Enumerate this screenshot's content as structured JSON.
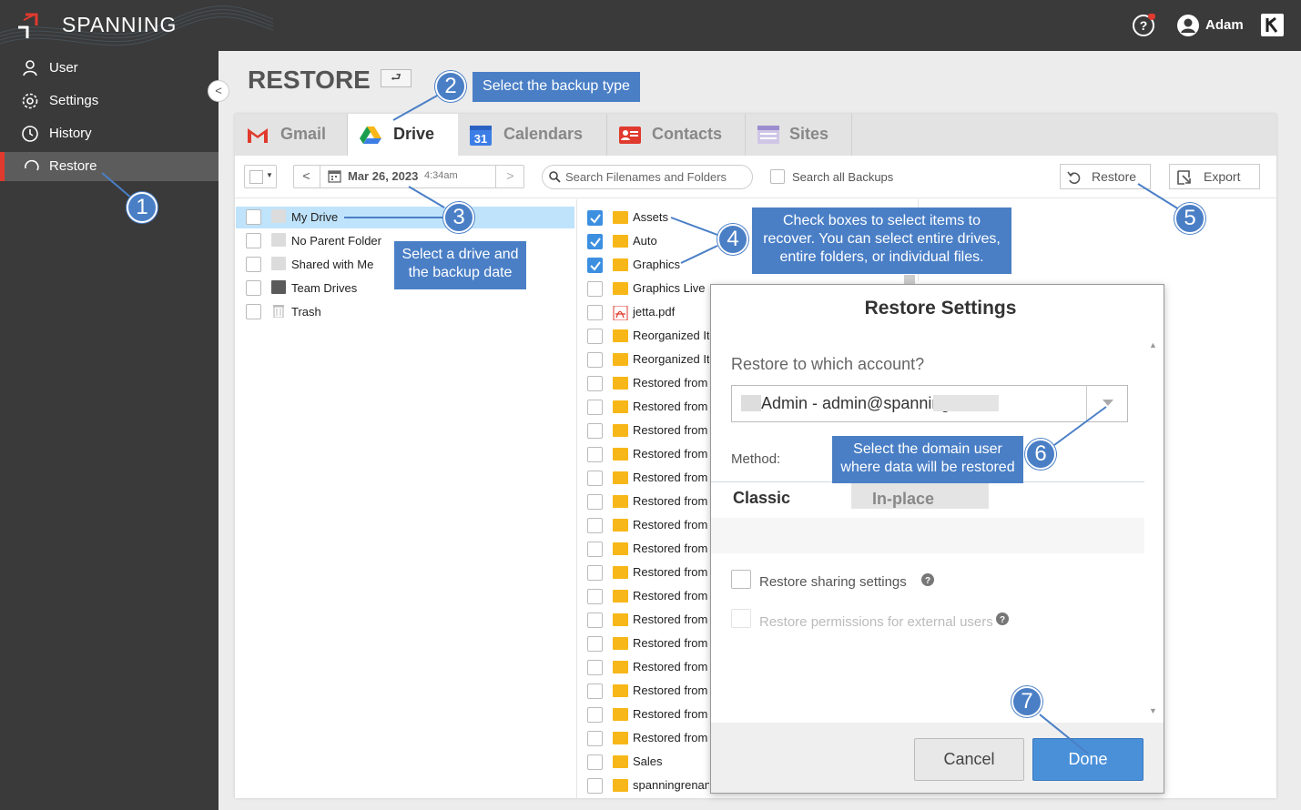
{
  "app": {
    "name": "SPANNING",
    "user": "Adam"
  },
  "sidebar": {
    "items": [
      {
        "label": "User",
        "icon": "user-icon"
      },
      {
        "label": "Settings",
        "icon": "gear-icon"
      },
      {
        "label": "History",
        "icon": "clock-icon"
      },
      {
        "label": "Restore",
        "icon": "restore-icon",
        "active": true
      }
    ]
  },
  "page": {
    "title": "RESTORE",
    "back_label": "⮐"
  },
  "tabs": [
    {
      "label": "Gmail",
      "icon": "gmail-icon"
    },
    {
      "label": "Drive",
      "icon": "drive-icon",
      "active": true
    },
    {
      "label": "Calendars",
      "icon": "calendar-icon",
      "icon_text": "31"
    },
    {
      "label": "Contacts",
      "icon": "contacts-icon"
    },
    {
      "label": "Sites",
      "icon": "sites-icon"
    }
  ],
  "toolbar": {
    "date": "Mar 26, 2023",
    "time": "4:34am",
    "search_placeholder": "Search Filenames and Folders",
    "search_all_label": "Search all Backups",
    "restore_label": "Restore",
    "export_label": "Export"
  },
  "drives": [
    {
      "label": "My Drive",
      "selected": true
    },
    {
      "label": "No Parent Folder"
    },
    {
      "label": "Shared with Me"
    },
    {
      "label": "Team Drives"
    },
    {
      "label": "Trash"
    }
  ],
  "files": [
    {
      "label": "Assets",
      "type": "folder",
      "checked": true
    },
    {
      "label": "Auto",
      "type": "folder",
      "checked": true
    },
    {
      "label": "Graphics",
      "type": "folder",
      "checked": true
    },
    {
      "label": "Graphics Live",
      "type": "folder"
    },
    {
      "label": "jetta.pdf",
      "type": "pdf"
    },
    {
      "label": "Reorganized It",
      "type": "folder"
    },
    {
      "label": "Reorganized It",
      "type": "folder"
    },
    {
      "label": "Restored from",
      "type": "folder"
    },
    {
      "label": "Restored from",
      "type": "folder"
    },
    {
      "label": "Restored from",
      "type": "folder"
    },
    {
      "label": "Restored from",
      "type": "folder"
    },
    {
      "label": "Restored from",
      "type": "folder"
    },
    {
      "label": "Restored from",
      "type": "folder"
    },
    {
      "label": "Restored from",
      "type": "folder"
    },
    {
      "label": "Restored from",
      "type": "folder"
    },
    {
      "label": "Restored from",
      "type": "folder"
    },
    {
      "label": "Restored from",
      "type": "folder"
    },
    {
      "label": "Restored from",
      "type": "folder"
    },
    {
      "label": "Restored from",
      "type": "folder"
    },
    {
      "label": "Restored from",
      "type": "folder"
    },
    {
      "label": "Restored from",
      "type": "folder"
    },
    {
      "label": "Restored from",
      "type": "folder"
    },
    {
      "label": "Restored from",
      "type": "folder"
    },
    {
      "label": "Sales",
      "type": "folder"
    },
    {
      "label": "spanningrenan",
      "type": "folder"
    }
  ],
  "callouts": {
    "c2": "Select the backup type",
    "c3": "Select a drive and the backup date",
    "c4": "Check boxes to select items to recover. You can select entire drives, entire folders, or individual files.",
    "c6": "Select the domain user where data will be restored",
    "numbers": [
      "1",
      "2",
      "3",
      "4",
      "5",
      "6",
      "7"
    ]
  },
  "modal": {
    "title": "Restore Settings",
    "question": "Restore to which account?",
    "account_value": "Admin - admin@spanning            .com",
    "method_label": "Method:",
    "tab_classic": "Classic",
    "tab_inplace": "In-place",
    "opt_sharing": "Restore sharing settings",
    "opt_permissions": "Restore permissions for external users",
    "cancel_label": "Cancel",
    "done_label": "Done"
  },
  "colors": {
    "accent": "#4a7fc6",
    "done_button": "#4a90d9",
    "sidebar": "#3a3a3a",
    "active_marker": "#e03a2e",
    "folder": "#f7b718"
  }
}
